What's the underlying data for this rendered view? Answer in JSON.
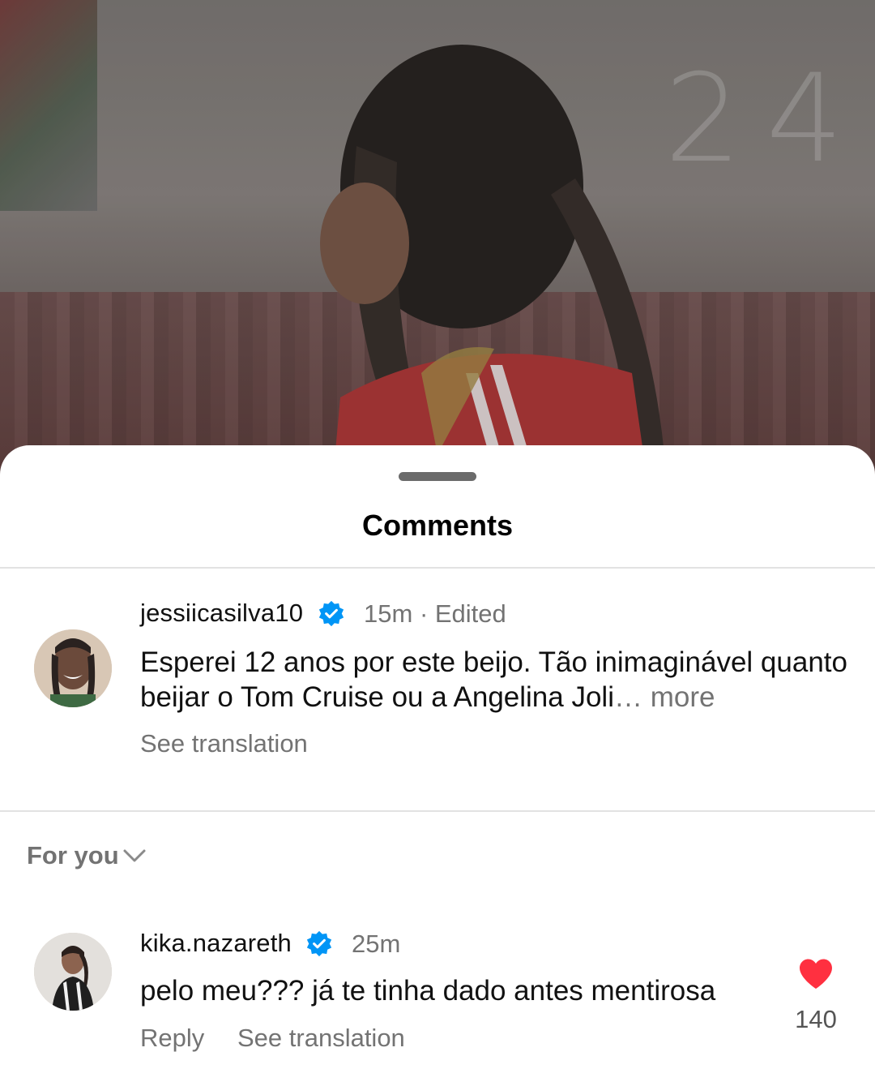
{
  "sheet": {
    "title": "Comments"
  },
  "caption_comment": {
    "username": "jessiicasilva10",
    "verified": true,
    "time": "15m",
    "edited_label": "· Edited",
    "text": "Esperei 12 anos por este beijo. Tão inimaginável quanto beijar o Tom Cruise ou a Angelina Joli",
    "more_label": "… more",
    "see_translation": "See translation"
  },
  "sort": {
    "label": "For you",
    "icon": "chevron-down-icon"
  },
  "comments": [
    {
      "username": "kika.nazareth",
      "verified": true,
      "time": "25m",
      "text": "pelo meu??? já te tinha dado antes mentirosa",
      "reply_label": "Reply",
      "see_translation": "See translation",
      "likes": "140",
      "liked": true
    }
  ],
  "colors": {
    "verified": "#0095f6",
    "heart": "#ff3040",
    "muted_text": "#737373"
  }
}
